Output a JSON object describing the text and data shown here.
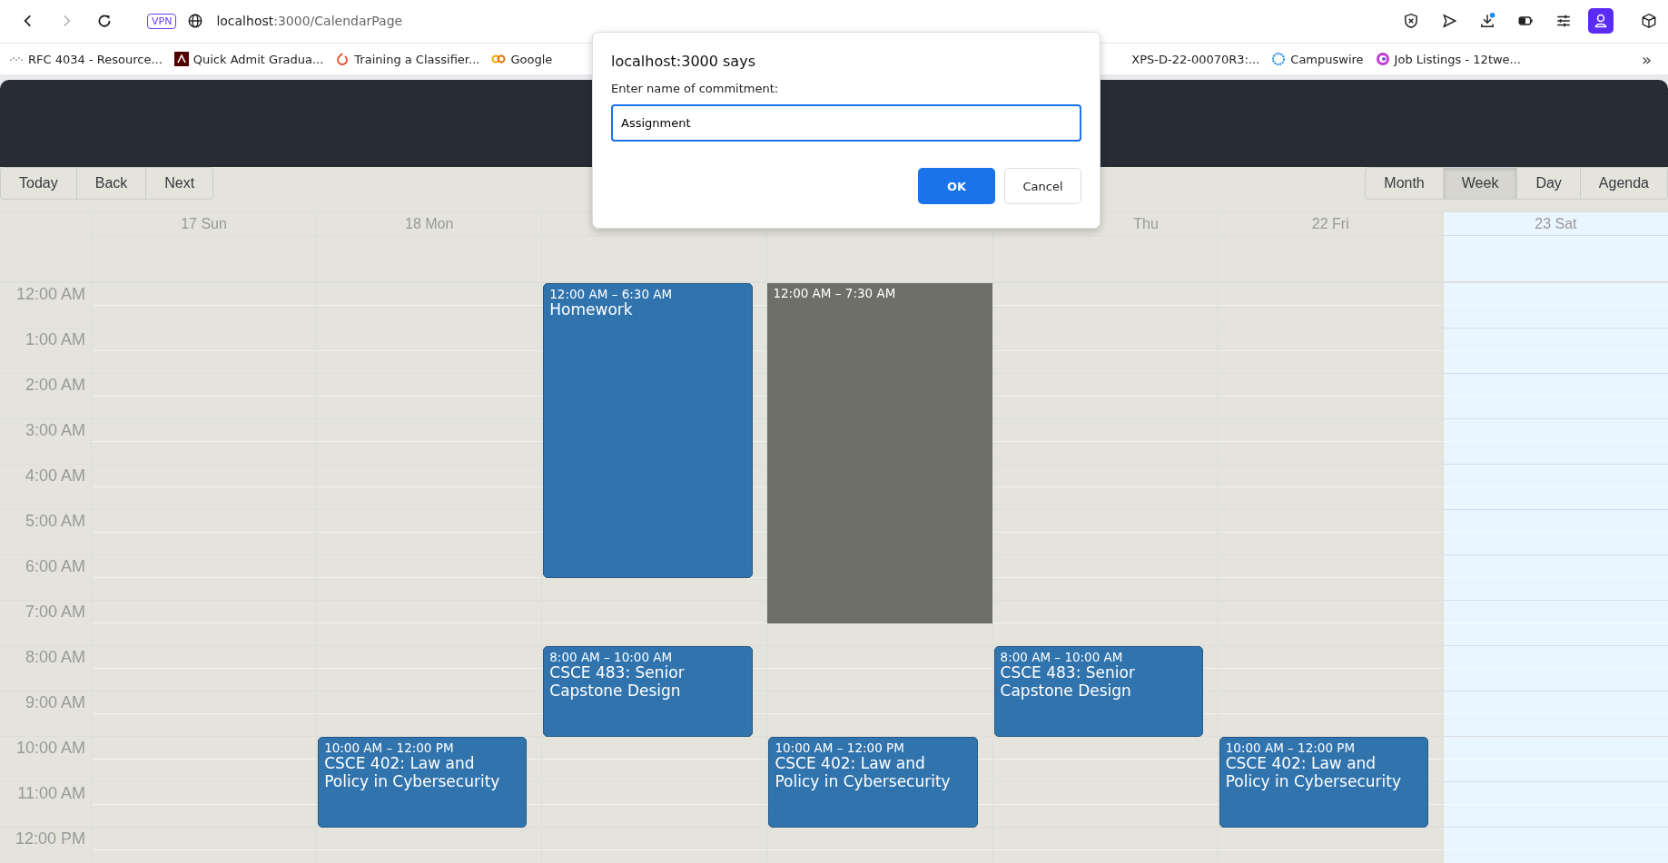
{
  "browser": {
    "url_host": "localhost",
    "url_path": ":3000/CalendarPage",
    "vpn_badge": "VPN",
    "forward_disabled": true,
    "download_dot": true
  },
  "bookmarks": [
    {
      "label": "RFC 4034 - Resource...",
      "kind": "dots"
    },
    {
      "label": "Quick Admit Gradua...",
      "kind": "crest"
    },
    {
      "label": "Training a Classifier...",
      "kind": "flame"
    },
    {
      "label": "Google",
      "kind": "loops"
    },
    {
      "label": "XPS-D-22-00070R3:...",
      "kind": "plain"
    },
    {
      "label": "Campuswire",
      "kind": "ring"
    },
    {
      "label": "Job Listings - 12twe...",
      "kind": "target"
    }
  ],
  "bookmarks_more": "»",
  "calendar": {
    "nav_buttons": [
      "Today",
      "Back",
      "Next"
    ],
    "views": [
      {
        "label": "Month",
        "selected": false
      },
      {
        "label": "Week",
        "selected": true
      },
      {
        "label": "Day",
        "selected": false
      },
      {
        "label": "Agenda",
        "selected": false
      }
    ],
    "time_labels": [
      "12:00 AM",
      "1:00 AM",
      "2:00 AM",
      "3:00 AM",
      "4:00 AM",
      "5:00 AM",
      "6:00 AM",
      "7:00 AM",
      "8:00 AM",
      "9:00 AM",
      "10:00 AM",
      "11:00 AM",
      "12:00 PM"
    ],
    "days": [
      {
        "label": "17 Sun",
        "today": false
      },
      {
        "label": "18 Mon",
        "today": false,
        "events": [
          {
            "kind": "event",
            "time": "10:00 AM – 12:00 PM",
            "title": "CSCE 402: Law and Policy in Cybersecurity"
          }
        ]
      },
      {
        "today": false,
        "events": [
          {
            "kind": "event",
            "time": "12:00 AM – 6:30 AM",
            "title": "Homework"
          },
          {
            "kind": "event",
            "time": "8:00 AM – 10:00 AM",
            "title": "CSCE 483: Senior Capstone Design"
          }
        ]
      },
      {
        "today": false,
        "events": [
          {
            "kind": "selection",
            "time": "12:00 AM – 7:30 AM"
          },
          {
            "kind": "event",
            "time": "10:00 AM – 12:00 PM",
            "title": "CSCE 402: Law and Policy in Cybersecurity"
          }
        ]
      },
      {
        "label": "Thu",
        "today": false,
        "partly_covered": true,
        "events": [
          {
            "kind": "event",
            "time": "8:00 AM – 10:00 AM",
            "title": "CSCE 483: Senior Capstone Design"
          }
        ]
      },
      {
        "label": "22 Fri",
        "today": false,
        "events": [
          {
            "kind": "event",
            "time": "10:00 AM – 12:00 PM",
            "title": "CSCE 402: Law and Policy in Cybersecurity"
          }
        ]
      },
      {
        "label": "23 Sat",
        "today": true
      }
    ]
  },
  "dialog": {
    "title": "localhost:3000 says",
    "message": "Enter name of commitment:",
    "value": "Assignment",
    "buttons": [
      {
        "label": "OK",
        "kind": "primary"
      },
      {
        "label": "Cancel",
        "kind": "secondary"
      }
    ]
  }
}
